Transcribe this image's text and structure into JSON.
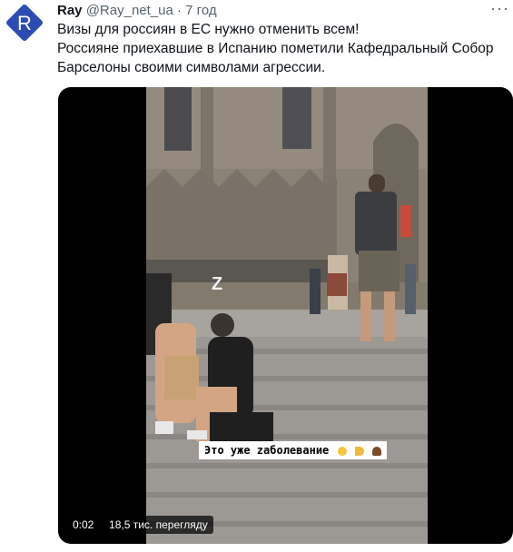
{
  "account": {
    "name": "Ray",
    "handle": "@Ray_net_ua",
    "separator": "·",
    "time": "7 год",
    "avatar_letter": "R",
    "avatar_color": "#2b4db3"
  },
  "more_icon": "more-horizontal-icon",
  "tweet_text": [
    "Визы для россиян в ЕС нужно отменить всем!",
    "Россияне приехавшие в Испанию пометили Кафедральный Собор Барселоны своими символами агрессии."
  ],
  "video": {
    "caption": "Это уже zаболевание",
    "scene_mark": "Z",
    "time": "0:02",
    "views": "18,5 тис. перегляду"
  }
}
